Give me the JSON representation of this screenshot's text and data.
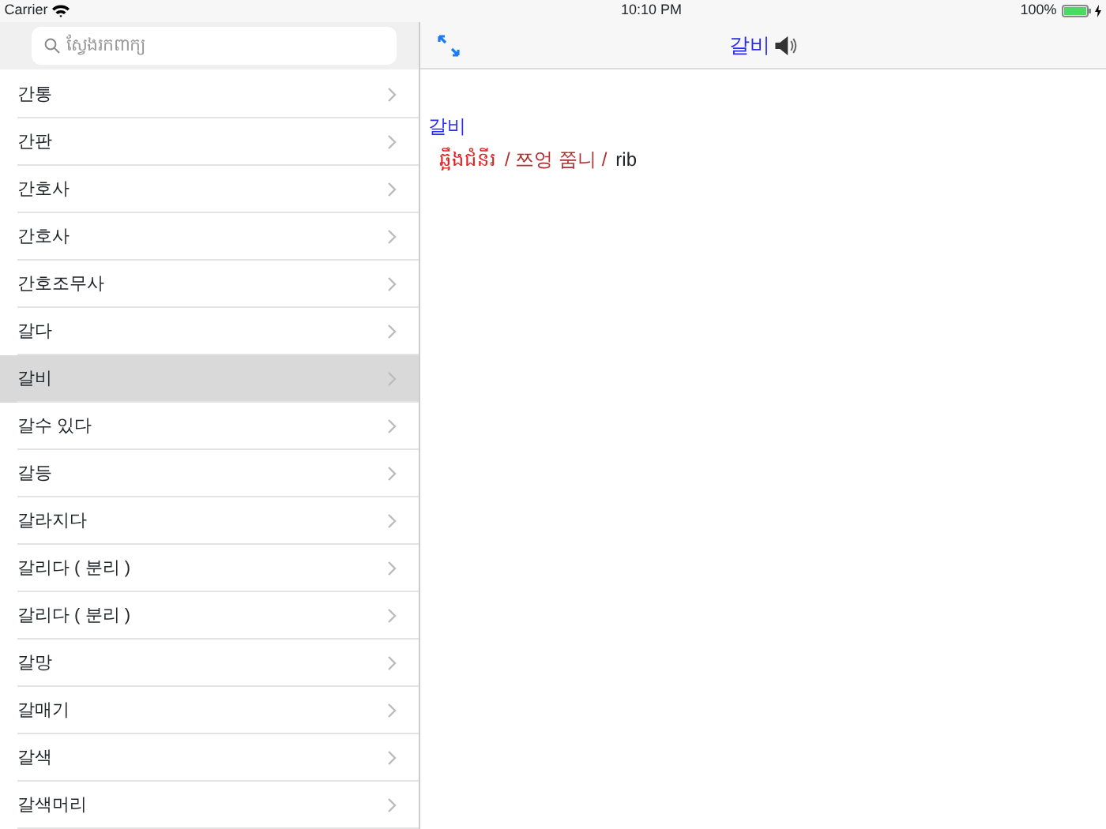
{
  "status_bar": {
    "carrier": "Carrier",
    "time": "10:10 PM",
    "battery": "100%"
  },
  "sidebar": {
    "search": {
      "placeholder": "ស្វែងរកពាក្យ"
    },
    "items": [
      {
        "label": "간통",
        "selected": false
      },
      {
        "label": "간판",
        "selected": false
      },
      {
        "label": "간호사",
        "selected": false
      },
      {
        "label": "간호사",
        "selected": false
      },
      {
        "label": "간호조무사",
        "selected": false
      },
      {
        "label": "갈다",
        "selected": false
      },
      {
        "label": "갈비",
        "selected": true
      },
      {
        "label": "갈수 있다",
        "selected": false
      },
      {
        "label": "갈등",
        "selected": false
      },
      {
        "label": "갈라지다",
        "selected": false
      },
      {
        "label": "갈리다 ( 분리 )",
        "selected": false
      },
      {
        "label": "갈리다 ( 분리 )",
        "selected": false
      },
      {
        "label": "갈망",
        "selected": false
      },
      {
        "label": "갈매기",
        "selected": false
      },
      {
        "label": "갈색",
        "selected": false
      },
      {
        "label": "갈색머리",
        "selected": false
      }
    ]
  },
  "detail": {
    "title": "갈비",
    "headword": "갈비",
    "translation": "ឆ្អឹងជំនីរ",
    "pronunciation": "/ 쯔엉 쭘니 /",
    "english": "rib"
  }
}
